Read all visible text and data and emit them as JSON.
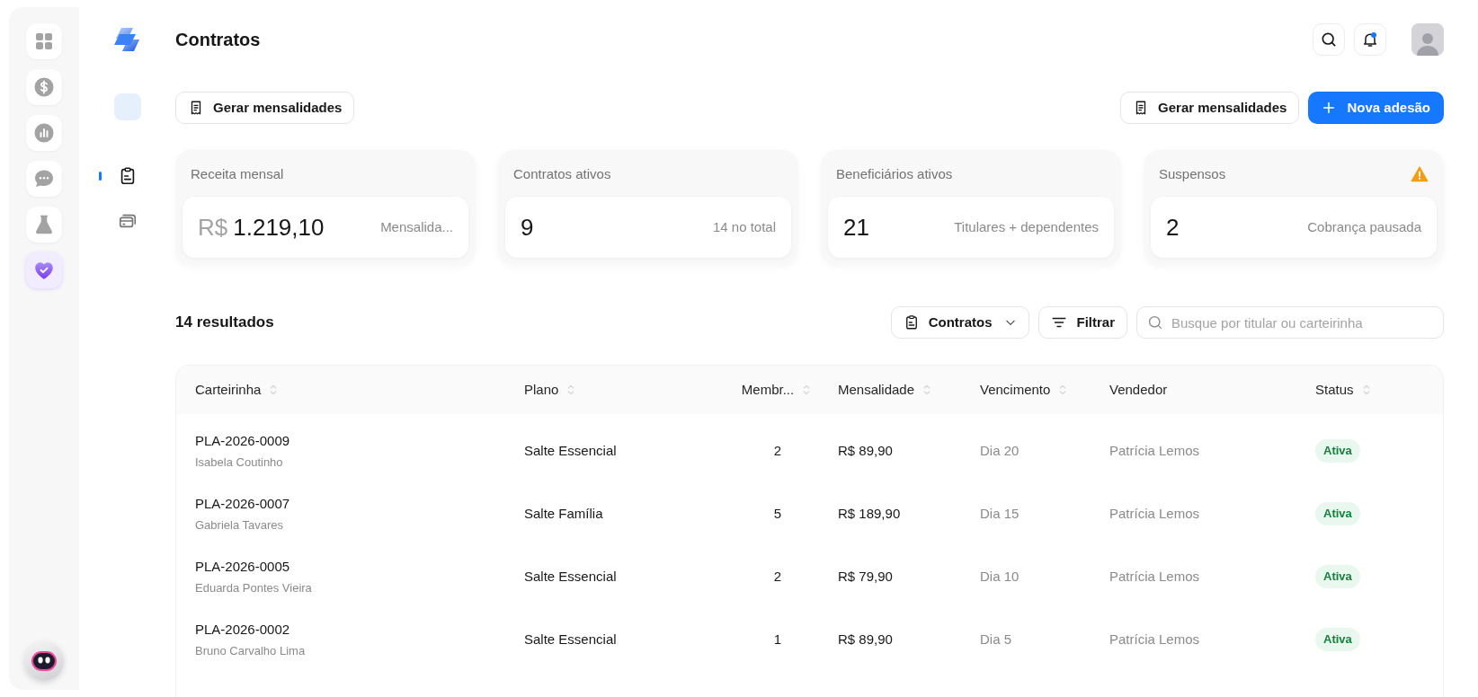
{
  "rail": {
    "items": [
      {
        "selected": false
      },
      {
        "selected": false
      },
      {
        "selected": false
      },
      {
        "selected": false
      },
      {
        "selected": false
      },
      {
        "selected": true
      }
    ]
  },
  "subnav": {
    "items": [
      {
        "selected": true
      },
      {
        "selected": false
      }
    ]
  },
  "header": {
    "title": "Contratos",
    "has_unread": true
  },
  "actions": {
    "left": [
      "Gerar mensalidades"
    ],
    "right": [
      {
        "kind": "secondary",
        "label": "Gerar mensalidades"
      },
      {
        "kind": "primary",
        "label": "Nova adesão"
      }
    ]
  },
  "stats": [
    {
      "label": "Receita mensal",
      "currency": "R$",
      "value": "1.219,10",
      "note": "Mensalida...",
      "warning": false
    },
    {
      "label": "Contratos ativos",
      "value": "9",
      "note": "14 no total",
      "warning": false
    },
    {
      "label": "Beneficiários ativos",
      "value": "21",
      "note": "Titulares + dependentes",
      "warning": false
    },
    {
      "label": "Suspensos",
      "value": "2",
      "note": "Cobrança pausada",
      "warning": true
    }
  ],
  "results": "14 resultados",
  "toolbar": {
    "view": "Contratos",
    "filter": "Filtrar",
    "search": {
      "placeholder": "Busque por titular ou carteirinha"
    }
  },
  "table": {
    "columns": [
      {
        "label": "Carteirinha",
        "sortable": true
      },
      {
        "label": "Plano",
        "sortable": true
      },
      {
        "label": "Membr...",
        "sortable": true
      },
      {
        "label": "Mensalidade",
        "sortable": true
      },
      {
        "label": "Vencimento",
        "sortable": true
      },
      {
        "label": "Vendedor",
        "sortable": false
      },
      {
        "label": "Status",
        "sortable": true
      }
    ],
    "rows": [
      {
        "card": "PLA-2026-0009",
        "holder": "Isabela Coutinho",
        "plan": "Salte Essencial",
        "members": "2",
        "fee": "R$ 89,90",
        "due": "Dia 20",
        "seller": "Patrícia Lemos",
        "status": "Ativa"
      },
      {
        "card": "PLA-2026-0007",
        "holder": "Gabriela Tavares",
        "plan": "Salte Família",
        "members": "5",
        "fee": "R$ 189,90",
        "due": "Dia 15",
        "seller": "Patrícia Lemos",
        "status": "Ativa"
      },
      {
        "card": "PLA-2026-0005",
        "holder": "Eduarda Pontes Vieira",
        "plan": "Salte Essencial",
        "members": "2",
        "fee": "R$ 79,90",
        "due": "Dia 10",
        "seller": "Patrícia Lemos",
        "status": "Ativa"
      },
      {
        "card": "PLA-2026-0002",
        "holder": "Bruno Carvalho Lima",
        "plan": "Salte Essencial",
        "members": "1",
        "fee": "R$ 89,90",
        "due": "Dia 5",
        "seller": "Patrícia Lemos",
        "status": "Ativa"
      }
    ]
  }
}
